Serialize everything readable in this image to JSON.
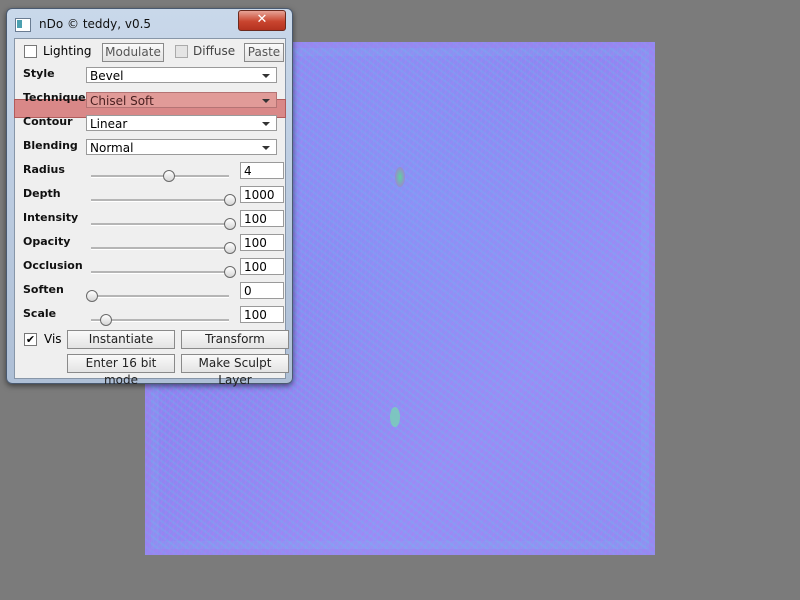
{
  "window": {
    "title": "nDo © teddy, v0.5",
    "close_label": "✕"
  },
  "top_row": {
    "lighting": {
      "label": "Lighting",
      "checked": false
    },
    "modulate_label": "Modulate",
    "diffuse": {
      "label": "Diffuse",
      "checked": false
    },
    "paste_label": "Paste"
  },
  "dropdowns": {
    "style": {
      "label": "Style",
      "value": "Bevel"
    },
    "technique": {
      "label": "Technique",
      "value": "Chisel Soft"
    },
    "contour": {
      "label": "Contour",
      "value": "Linear"
    },
    "blending": {
      "label": "Blending",
      "value": "Normal"
    }
  },
  "sliders": [
    {
      "label": "Radius",
      "value": "4",
      "level": 0.56
    },
    {
      "label": "Depth",
      "value": "1000",
      "level": 1.0
    },
    {
      "label": "Intensity",
      "value": "100",
      "level": 1.0
    },
    {
      "label": "Opacity",
      "value": "100",
      "level": 1.0
    },
    {
      "label": "Occlusion",
      "value": "100",
      "level": 1.0
    },
    {
      "label": "Soften",
      "value": "0",
      "level": 0.0
    },
    {
      "label": "Scale",
      "value": "100",
      "level": 0.1
    }
  ],
  "bottom": {
    "vis": {
      "label": "Vis",
      "checked": true,
      "mark": "✔"
    },
    "instantiate_label": "Instantiate",
    "transform_label": "Transform",
    "enter16_label": "Enter 16 bit mode",
    "sculpt_label": "Make Sculpt Layer"
  },
  "colors": {
    "highlight": "#d98888",
    "canvas_base": "#8f8df3"
  }
}
